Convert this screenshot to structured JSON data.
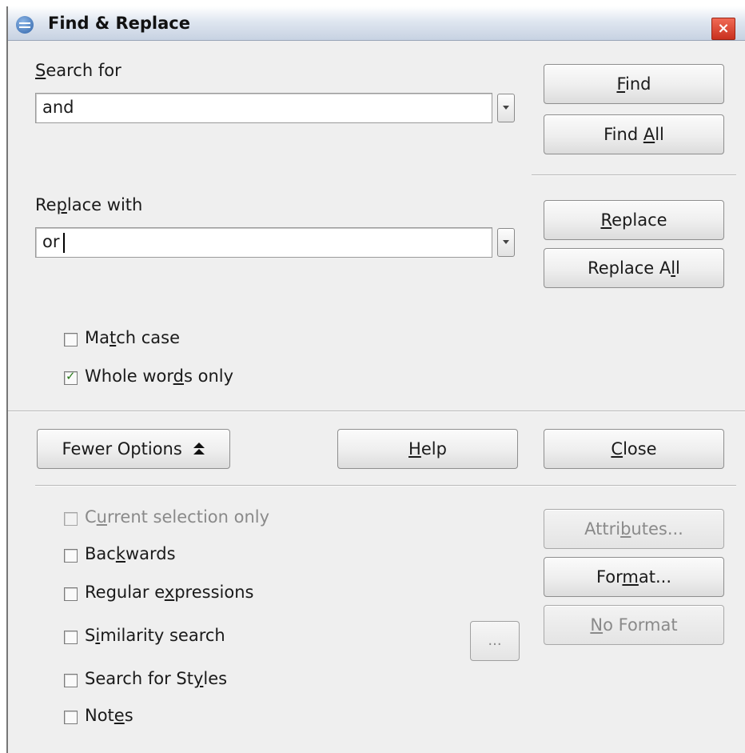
{
  "window": {
    "title": "Find & Replace",
    "close_glyph": "×"
  },
  "search": {
    "label_first": "S",
    "label_rest": "earch for",
    "value": "and"
  },
  "replace": {
    "label_pre": "Re",
    "label_u": "p",
    "label_rest": "lace with",
    "value": "or"
  },
  "buttons": {
    "find_u": "F",
    "find_rest": "ind",
    "findall_pre": "Find ",
    "findall_u": "A",
    "findall_rest": "ll",
    "replace_u": "R",
    "replace_rest": "eplace",
    "replaceall_pre": "Replace A",
    "replaceall_u": "l",
    "replaceall_rest": "l",
    "fewer_options": "Fewer Options",
    "help_u": "H",
    "help_rest": "elp",
    "close_u": "C",
    "close_rest": "lose",
    "attributes_pre": "Attri",
    "attributes_u": "b",
    "attributes_rest": "utes...",
    "format_pre": "For",
    "format_u": "m",
    "format_rest": "at...",
    "noformat_u": "N",
    "noformat_rest": "o Format",
    "similarity_dots": "..."
  },
  "options": {
    "match_case": {
      "pre": "Ma",
      "u": "t",
      "rest": "ch case",
      "checked": false
    },
    "whole_words": {
      "pre": "Whole wor",
      "u": "d",
      "rest": "s only",
      "checked": true
    },
    "current_selection": {
      "pre": "C",
      "u": "u",
      "rest": "rrent selection only",
      "checked": false,
      "disabled": true
    },
    "backwards": {
      "pre": "Bac",
      "u": "k",
      "rest": "wards",
      "checked": false
    },
    "regex": {
      "pre": "Regular e",
      "u": "x",
      "rest": "pressions",
      "checked": false
    },
    "similarity": {
      "pre": "S",
      "u": "i",
      "rest": "milarity search",
      "checked": false
    },
    "styles": {
      "pre": "Search for St",
      "u": "y",
      "rest": "les",
      "checked": false
    },
    "notes": {
      "pre": "Not",
      "u": "e",
      "rest": "s",
      "checked": false
    }
  },
  "colors": {
    "title_bar": "#c7d2e2",
    "dialog_bg": "#efefef",
    "close_btn": "#c9301e",
    "disabled_text": "#8a8a8a"
  }
}
